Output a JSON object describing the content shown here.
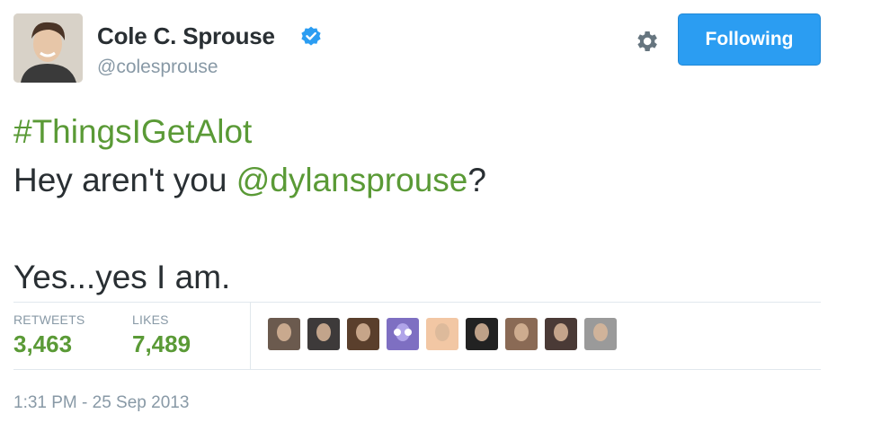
{
  "user": {
    "display_name": "Cole C. Sprouse",
    "handle": "@colesprouse",
    "verified": true
  },
  "actions": {
    "follow_label": "Following",
    "settings_icon": "gear-icon"
  },
  "tweet": {
    "hashtag": "#ThingsIGetAlot",
    "line2_prefix": "Hey aren't you ",
    "mention": "@dylansprouse",
    "line2_suffix": "?",
    "line3": "Yes...yes I am."
  },
  "stats": {
    "retweets_label": "RETWEETS",
    "retweets_value": "3,463",
    "likes_label": "LIKES",
    "likes_value": "7,489"
  },
  "likers": [
    {
      "name": "liker-avatar-1",
      "color": "#6b5a4e"
    },
    {
      "name": "liker-avatar-2",
      "color": "#3d3a3a"
    },
    {
      "name": "liker-avatar-3",
      "color": "#5a3f2c"
    },
    {
      "name": "liker-avatar-4",
      "color": "#7e6fc2"
    },
    {
      "name": "liker-avatar-5",
      "color": "#f2c7a4"
    },
    {
      "name": "liker-avatar-6",
      "color": "#222222"
    },
    {
      "name": "liker-avatar-7",
      "color": "#8a6a55"
    },
    {
      "name": "liker-avatar-8",
      "color": "#4a3a36"
    },
    {
      "name": "liker-avatar-9",
      "color": "#9a9a9a"
    }
  ],
  "timestamp": "1:31 PM - 25 Sep 2013",
  "colors": {
    "accent_link": "#5a9a36",
    "follow_button": "#2b9df2",
    "verified_badge": "#2b9df2",
    "muted_text": "#8899a6"
  }
}
